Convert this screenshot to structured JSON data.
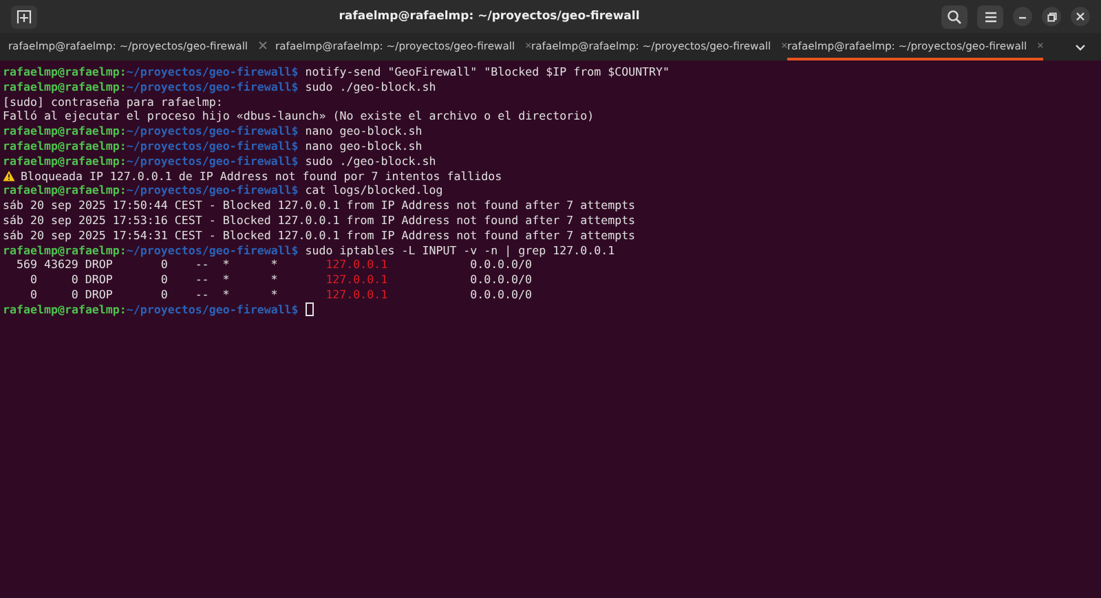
{
  "window": {
    "title": "rafaelmp@rafaelmp: ~/proyectos/geo-firewall"
  },
  "tabs": [
    {
      "label": "rafaelmp@rafaelmp: ~/proyectos/geo-firewall",
      "selected": false
    },
    {
      "label": "rafaelmp@rafaelmp: ~/proyectos/geo-firewall",
      "selected": false
    },
    {
      "label": "rafaelmp@rafaelmp: ~/proyectos/geo-firewall",
      "selected": false
    },
    {
      "label": "rafaelmp@rafaelmp: ~/proyectos/geo-firewall",
      "selected": true
    }
  ],
  "terminal": {
    "lines": [
      {
        "kind": "prompt",
        "user": "rafaelmp@rafaelmp:",
        "path": "~/proyectos/geo-firewall$",
        "command": "notify-send \"GeoFirewall\" \"Blocked $IP from $COUNTRY\""
      },
      {
        "kind": "prompt",
        "user": "rafaelmp@rafaelmp:",
        "path": "~/proyectos/geo-firewall$",
        "command": "sudo ./geo-block.sh"
      },
      {
        "kind": "output",
        "text": "[sudo] contraseña para rafaelmp:"
      },
      {
        "kind": "output",
        "text": "Falló al ejecutar el proceso hijo «dbus-launch» (No existe el archivo o el directorio)"
      },
      {
        "kind": "prompt",
        "user": "rafaelmp@rafaelmp:",
        "path": "~/proyectos/geo-firewall$",
        "command": "nano geo-block.sh"
      },
      {
        "kind": "prompt",
        "user": "rafaelmp@rafaelmp:",
        "path": "~/proyectos/geo-firewall$",
        "command": "nano geo-block.sh"
      },
      {
        "kind": "prompt",
        "user": "rafaelmp@rafaelmp:",
        "path": "~/proyectos/geo-firewall$",
        "command": "sudo ./geo-block.sh"
      },
      {
        "kind": "warning",
        "text": "Bloqueada IP 127.0.0.1 de IP Address not found por 7 intentos fallidos"
      },
      {
        "kind": "prompt",
        "user": "rafaelmp@rafaelmp:",
        "path": "~/proyectos/geo-firewall$",
        "command": "cat logs/blocked.log"
      },
      {
        "kind": "output",
        "text": "sáb 20 sep 2025 17:50:44 CEST - Blocked 127.0.0.1 from IP Address not found after 7 attempts"
      },
      {
        "kind": "output",
        "text": "sáb 20 sep 2025 17:53:16 CEST - Blocked 127.0.0.1 from IP Address not found after 7 attempts"
      },
      {
        "kind": "output",
        "text": "sáb 20 sep 2025 17:54:31 CEST - Blocked 127.0.0.1 from IP Address not found after 7 attempts"
      },
      {
        "kind": "prompt",
        "user": "rafaelmp@rafaelmp:",
        "path": "~/proyectos/geo-firewall$",
        "command": "sudo iptables -L INPUT -v -n | grep 127.0.0.1"
      },
      {
        "kind": "rule",
        "pkts": "569",
        "bytes": "43629",
        "target": "DROP",
        "prot": "0",
        "opt": "--",
        "in": "*",
        "out": "*",
        "source": "127.0.0.1",
        "destination": "0.0.0.0/0"
      },
      {
        "kind": "rule",
        "pkts": "0",
        "bytes": "0",
        "target": "DROP",
        "prot": "0",
        "opt": "--",
        "in": "*",
        "out": "*",
        "source": "127.0.0.1",
        "destination": "0.0.0.0/0"
      },
      {
        "kind": "rule",
        "pkts": "0",
        "bytes": "0",
        "target": "DROP",
        "prot": "0",
        "opt": "--",
        "in": "*",
        "out": "*",
        "source": "127.0.0.1",
        "destination": "0.0.0.0/0"
      },
      {
        "kind": "prompt",
        "user": "rafaelmp@rafaelmp:",
        "path": "~/proyectos/geo-firewall$",
        "cursor": true
      }
    ]
  }
}
